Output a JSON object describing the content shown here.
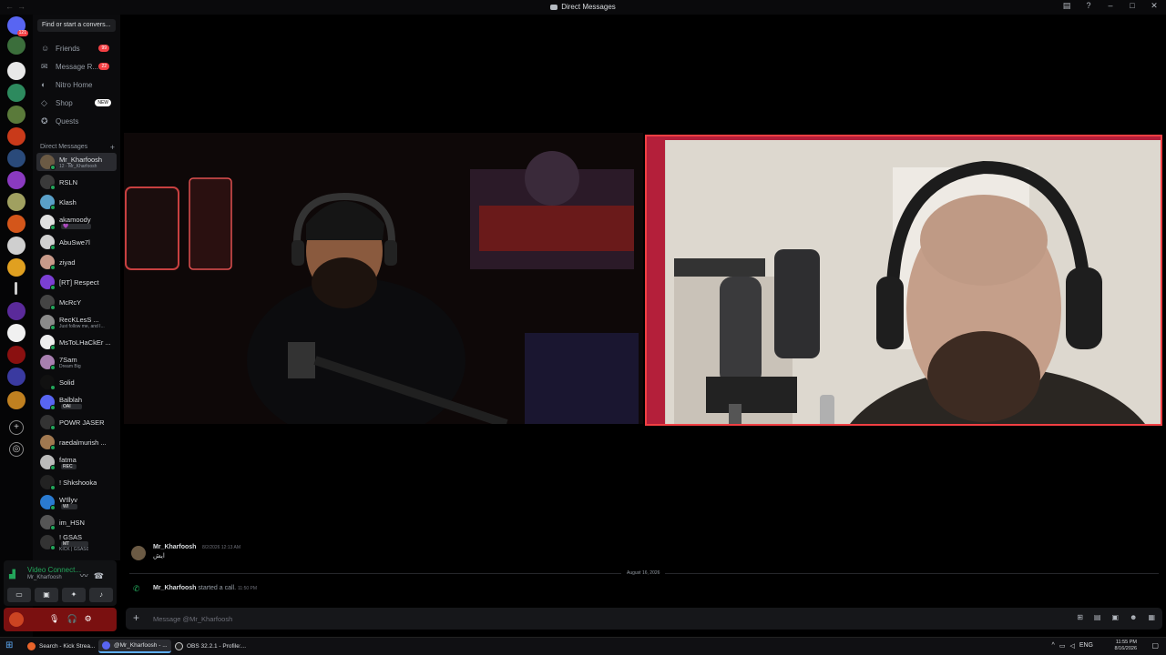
{
  "window": {
    "title": "Direct Messages"
  },
  "sidebar": {
    "search_placeholder": "Find or start a convers...",
    "nav": [
      {
        "label": "Friends",
        "badge": "99",
        "icon": "friends-icon"
      },
      {
        "label": "Message R...",
        "badge": "22",
        "icon": "message-requests-icon"
      },
      {
        "label": "Nitro Home",
        "badge": "",
        "icon": "nitro-icon"
      },
      {
        "label": "Shop",
        "badge": "NEW",
        "icon": "shop-icon"
      },
      {
        "label": "Quests",
        "badge": "",
        "icon": "quests-icon"
      }
    ],
    "dm_header": "Direct Messages",
    "dms": [
      {
        "name": "Mr_Kharfoosh",
        "sub": "12 · Mr_Kharfoosh",
        "color": "#6b5a44",
        "active": true
      },
      {
        "name": "RSLN",
        "sub": "",
        "color": "#3a3a3a"
      },
      {
        "name": "Klash",
        "sub": "",
        "color": "#5aa0c8"
      },
      {
        "name": "akamoody",
        "sub": "",
        "color": "#e0e0e0",
        "tag": "💜"
      },
      {
        "name": "AbuSwe7l",
        "sub": "",
        "color": "#d0d0d0"
      },
      {
        "name": "ziyad",
        "sub": "",
        "color": "#c89a8a"
      },
      {
        "name": "[RT] Respect",
        "sub": "",
        "color": "#7b3fd4"
      },
      {
        "name": "McRcY",
        "sub": "",
        "color": "#444"
      },
      {
        "name": "RecKLesS ...",
        "sub": "Just follow me, and I...",
        "color": "#8a8a8a"
      },
      {
        "name": "MsToLHaCkEr ...",
        "sub": "",
        "color": "#eee"
      },
      {
        "name": "7Sam",
        "sub": "Dream Big",
        "color": "#a87fb0"
      },
      {
        "name": "Solid",
        "sub": "",
        "color": "#111"
      },
      {
        "name": "Balblah",
        "sub": "",
        "color": "#5865f2",
        "tag": "OAI"
      },
      {
        "name": "POWR JASER",
        "sub": "",
        "color": "#333"
      },
      {
        "name": "raedalmurish ...",
        "sub": "",
        "color": "#a07850"
      },
      {
        "name": "fatma",
        "sub": "",
        "color": "#bbb",
        "tag": "REC"
      },
      {
        "name": "! Shkshooka",
        "sub": "",
        "color": "#222"
      },
      {
        "name": "W!llyv",
        "sub": "",
        "color": "#2a7ad0",
        "tag": "WI"
      },
      {
        "name": "im_HSN",
        "sub": "",
        "color": "#555"
      },
      {
        "name": "! GSAS",
        "sub": "KICK | GSAS0",
        "color": "#333",
        "tag": "MT"
      }
    ]
  },
  "voice": {
    "title": "Video Connect...",
    "sub": "Mr_Kharfoosh"
  },
  "chat": {
    "message_author": "Mr_Kharfoosh",
    "message_time": "8/2/2026 12:13 AM",
    "message_text": "ايش",
    "divider_date": "August 16, 2026",
    "call_author": "Mr_Kharfoosh",
    "call_text": "started a call.",
    "call_time": "11:50 PM",
    "composer_placeholder": "Message @Mr_Kharfoosh"
  },
  "taskbar": {
    "apps": [
      {
        "label": "Search - Kick Strea...",
        "color": "#e8632a"
      },
      {
        "label": "@Mr_Kharfoosh - ...",
        "color": "#5865f2",
        "active": true
      },
      {
        "label": "OBS 32.2.1 - Profile:...",
        "color": "#222"
      }
    ],
    "lang": "ENG",
    "time": "11:55 PM",
    "date": "8/16/2026"
  },
  "colors": {
    "accent": "#5865f2",
    "online": "#23a55a",
    "danger": "#f23f43"
  }
}
